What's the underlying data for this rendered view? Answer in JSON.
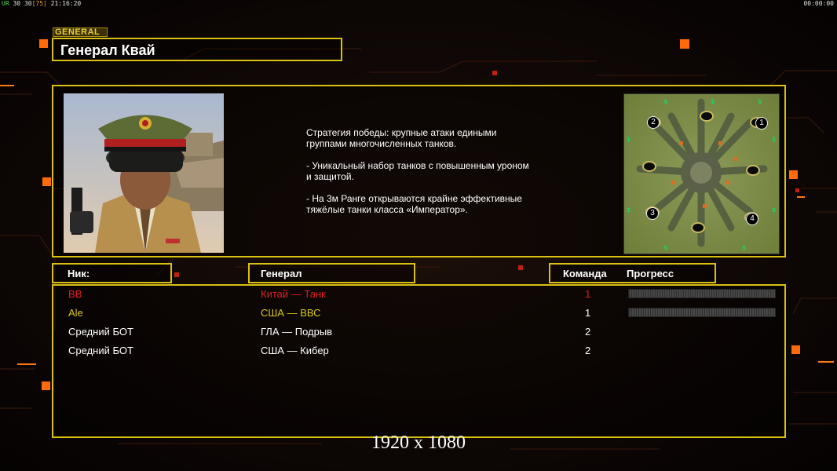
{
  "hud": {
    "top_left": [
      "UR",
      "30",
      "30",
      "[75]",
      "21:16:20"
    ],
    "top_right": "00:00:00"
  },
  "general": {
    "tag": "GENERAL",
    "name": "Генерал Квай"
  },
  "description": "Стратегия победы: крупные атаки едиными\n группами многочисленных танков.\n\n- Уникальный набор танков с повышенным уроном\n и защитой.\n\n- На 3м Ранге открываются крайне эффективные\n тяжёлые танки класса «Император».",
  "map": {
    "start_positions": [
      "1",
      "2",
      "3",
      "4"
    ]
  },
  "columns": {
    "nick": "Ник:",
    "general": "Генерал",
    "team": "Команда",
    "progress": "Прогресс"
  },
  "players": [
    {
      "nick": "BB",
      "general": "Китай — Танк",
      "team": "1",
      "color": "#e02020",
      "has_progress": true
    },
    {
      "nick": "Ale",
      "general": "США — ВВС",
      "team": "1",
      "color": "#d8c820",
      "has_progress": true
    },
    {
      "nick": "Средний БОТ",
      "general": "ГЛА — Подрыв",
      "team": "2",
      "color": "#ffffff",
      "has_progress": false
    },
    {
      "nick": "Средний БОТ",
      "general": "США — Кибер",
      "team": "2",
      "color": "#ffffff",
      "has_progress": false
    }
  ],
  "resolution_label": "1920 x 1080",
  "colors": {
    "frame": "#d9c012",
    "accent": "#ff7a10",
    "background": "#0a0504"
  }
}
